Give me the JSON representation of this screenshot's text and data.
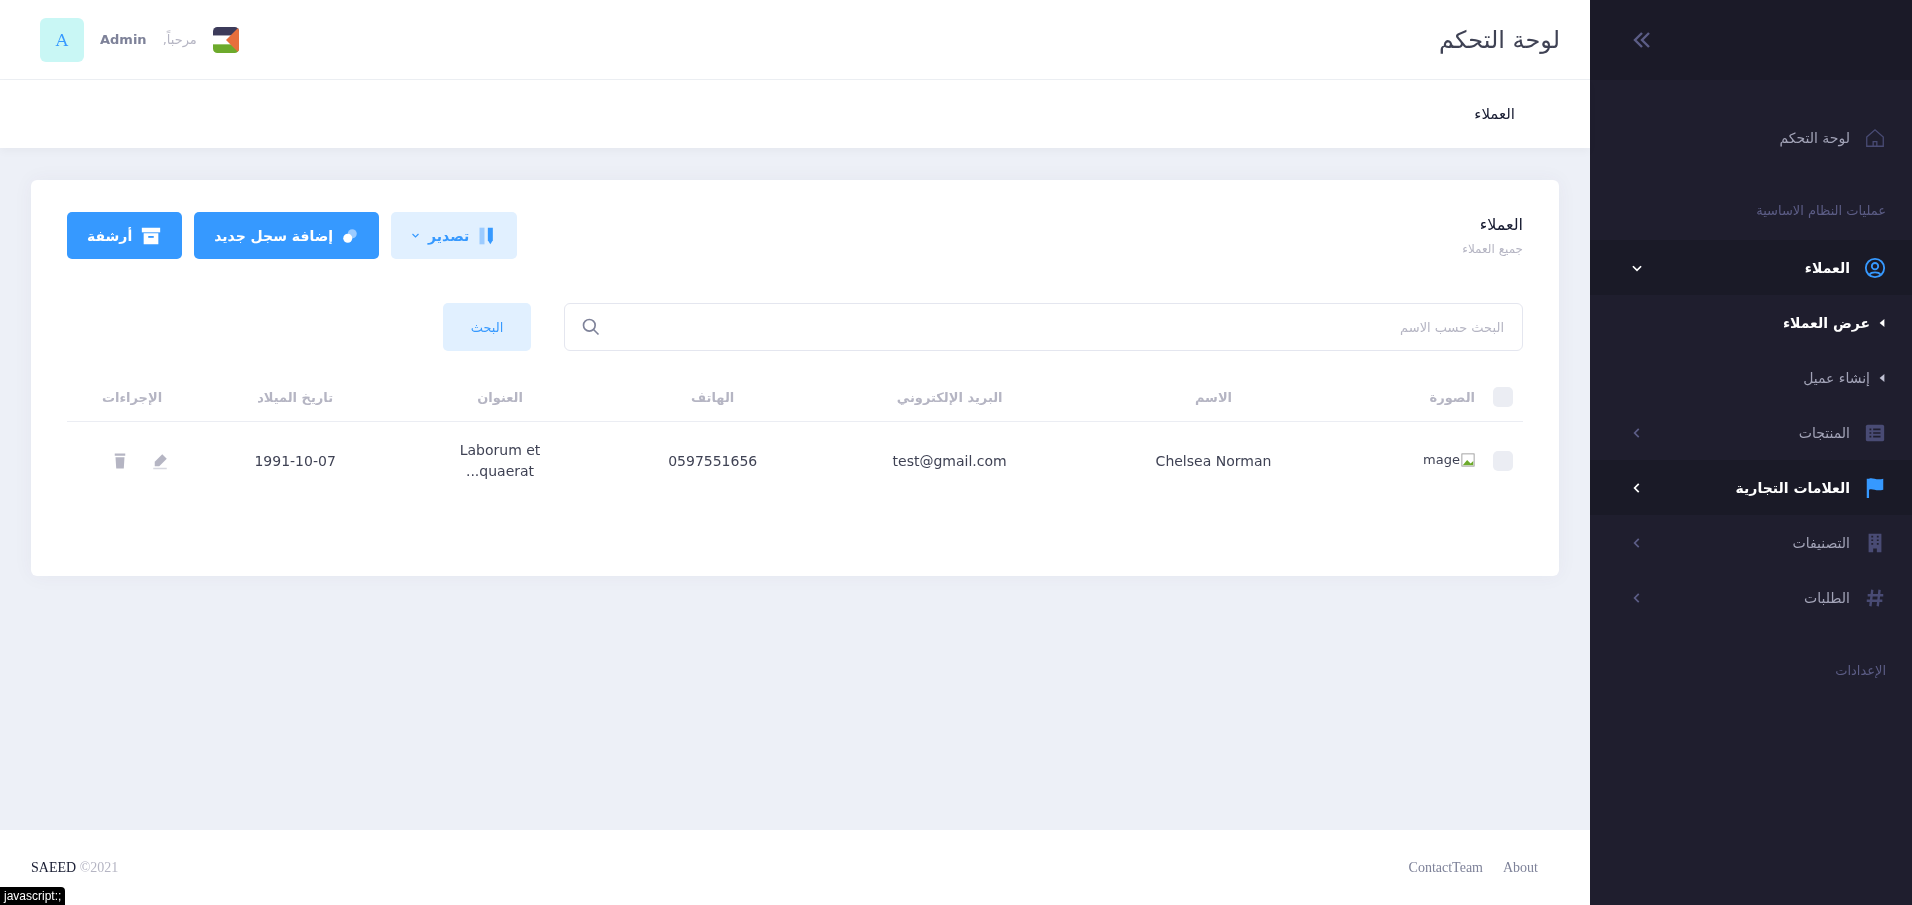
{
  "header": {
    "title": "لوحة التحكم",
    "greeting": "مرحباً,",
    "user": "Admin",
    "avatar": "A"
  },
  "breadcrumb": "العملاء",
  "sidebar": {
    "items": [
      {
        "kind": "link",
        "label": "لوحة التحكم",
        "selected": false
      },
      {
        "kind": "section",
        "label": "عمليات النظام الاساسية"
      },
      {
        "kind": "group",
        "label": "العملاء",
        "expanded": true,
        "selected": true,
        "children": [
          {
            "label": "عرض العملاء",
            "selected": true
          },
          {
            "label": "إنشاء عميل",
            "selected": false
          }
        ]
      },
      {
        "kind": "group",
        "label": "المنتجات",
        "expanded": false,
        "selected": false
      },
      {
        "kind": "group",
        "label": "العلامات التجارية",
        "expanded": false,
        "selected": true
      },
      {
        "kind": "group",
        "label": "التصنيفات",
        "expanded": false,
        "selected": false
      },
      {
        "kind": "group",
        "label": "الطلبات",
        "expanded": false,
        "selected": false
      },
      {
        "kind": "section",
        "label": "الإعدادات"
      }
    ]
  },
  "card": {
    "title": "العملاء",
    "subtitle": "جميع العملاء",
    "buttons": [
      {
        "kind": "export",
        "label": "تصدير"
      },
      {
        "kind": "add",
        "label": "إضافة سجل جديد"
      },
      {
        "kind": "archive",
        "label": "أرشفة"
      }
    ],
    "search": {
      "placeholder": "البحث حسب الاسم",
      "button": "البحث"
    },
    "table": {
      "columns": [
        "الصورة",
        "الاسم",
        "البريد الإلكتروني",
        "الهاتف",
        "العنوان",
        "تاريخ الميلاد",
        "الإجراءات"
      ],
      "all_checked": false,
      "rows": [
        {
          "checked": false,
          "image": "mage",
          "name": "Chelsea Norman",
          "email": "test@gmail.com",
          "phone": "0597551656",
          "address": "Laborum et quaerat...",
          "birthdate": "1991-10-07"
        }
      ]
    }
  },
  "footer": {
    "brand": "SAEED",
    "year": "©2021",
    "links": [
      "About",
      "ContactTeam"
    ]
  },
  "status_bar": "javascript:;"
}
